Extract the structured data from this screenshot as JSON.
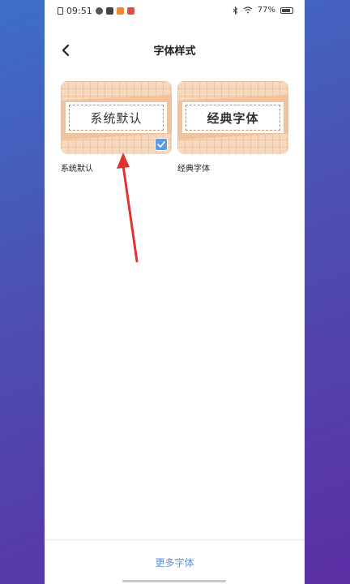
{
  "status_bar": {
    "time": "09:51",
    "battery": "77%",
    "icons": [
      "doc-icon",
      "notification-icon",
      "app-icon",
      "app-icon-orange",
      "app-icon-red",
      "bluetooth-icon",
      "wifi-icon",
      "battery-icon"
    ]
  },
  "header": {
    "back_icon": "chevron-left-icon",
    "title": "字体样式"
  },
  "fonts": [
    {
      "preview_text": "系统默认",
      "label": "系统默认",
      "selected": true
    },
    {
      "preview_text": "经典字体",
      "label": "经典字体",
      "selected": false
    }
  ],
  "footer": {
    "more_label": "更多字体"
  },
  "colors": {
    "accent": "#5b8fdc",
    "check": "#5b9ae6",
    "annotation_arrow": "#e0332f"
  }
}
